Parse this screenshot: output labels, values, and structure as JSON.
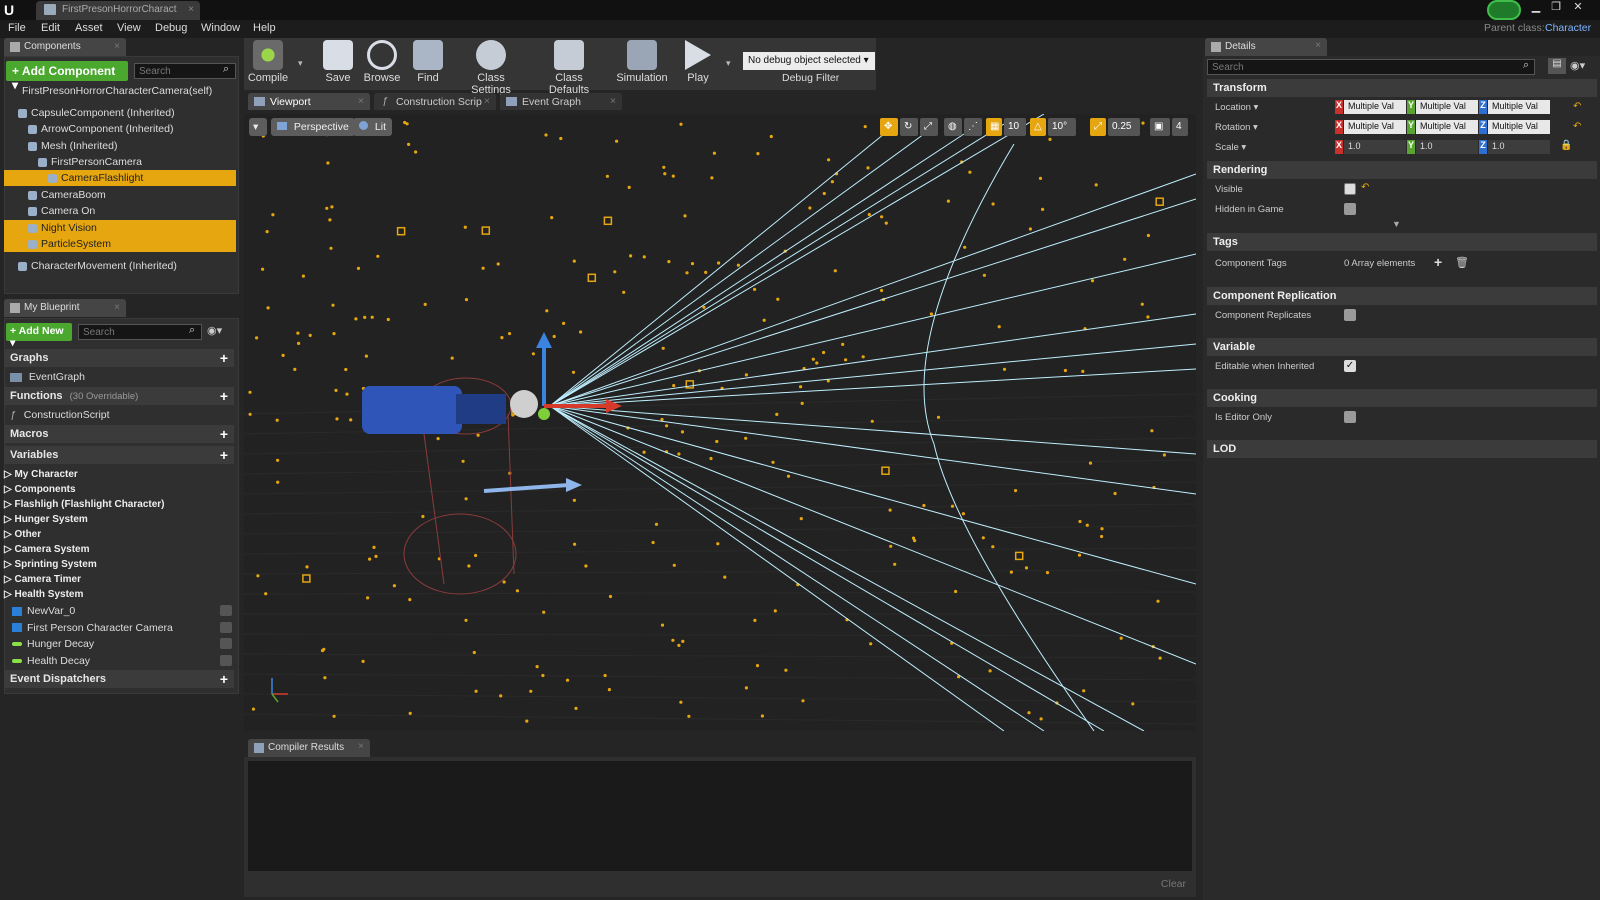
{
  "window": {
    "tab_title": "FirstPresonHorrorCharact",
    "parent_class_label": "Parent class:",
    "parent_class_value": "Character",
    "colors": {
      "accent": "#e5a60f",
      "green": "#4aa82e"
    }
  },
  "menu": [
    "File",
    "Edit",
    "Asset",
    "View",
    "Debug",
    "Window",
    "Help"
  ],
  "components_panel": {
    "tab": "Components",
    "add_button": "+ Add Component ▾",
    "search_placeholder": "Search",
    "self_label": "FirstPresonHorrorCharacterCamera(self)",
    "items": [
      {
        "label": "CapsuleComponent (Inherited)",
        "indent": 0,
        "selected": false
      },
      {
        "label": "ArrowComponent (Inherited)",
        "indent": 1,
        "selected": false
      },
      {
        "label": "Mesh (Inherited)",
        "indent": 1,
        "selected": false
      },
      {
        "label": "FirstPersonCamera",
        "indent": 2,
        "selected": false
      },
      {
        "label": "CameraFlashlight",
        "indent": 3,
        "selected": true
      },
      {
        "label": "CameraBoom",
        "indent": 1,
        "selected": false
      },
      {
        "label": "Camera On",
        "indent": 1,
        "selected": false
      },
      {
        "label": "Night Vision",
        "indent": 1,
        "selected": true
      },
      {
        "label": "ParticleSystem",
        "indent": 1,
        "selected": true
      },
      {
        "label": "CharacterMovement (Inherited)",
        "indent": 0,
        "selected": false
      }
    ]
  },
  "blueprint_panel": {
    "tab": "My Blueprint",
    "add_button": "+ Add New ▾",
    "search_placeholder": "Search",
    "graphs_header": "Graphs",
    "graphs_item": "EventGraph",
    "functions_header": "Functions",
    "functions_note": "(30 Overridable)",
    "functions_item": "ConstructionScript",
    "macros_header": "Macros",
    "variables_header": "Variables",
    "variable_categories": [
      "My Character",
      "Components",
      "Flashligh (Flashlight Character)",
      "Hunger System",
      "Other",
      "Camera System",
      "Sprinting System",
      "Camera Timer",
      "Health System"
    ],
    "variables": [
      {
        "name": "NewVar_0",
        "color": "#2a7fd6"
      },
      {
        "name": "First Person Character Camera",
        "color": "#2a7fd6"
      },
      {
        "name": "Hunger Decay",
        "color": "#8be04a"
      },
      {
        "name": "Health Decay",
        "color": "#8be04a"
      }
    ],
    "event_dispatchers": "Event Dispatchers"
  },
  "toolbar": {
    "buttons": [
      "Compile",
      "Save",
      "Browse",
      "Find",
      "Class Settings",
      "Class Defaults",
      "Simulation",
      "Play"
    ],
    "debug_select": "No debug object selected ▾",
    "debug_filter": "Debug Filter"
  },
  "editor_tabs": [
    "Viewport",
    "Construction Scrip",
    "Event Graph"
  ],
  "viewport": {
    "perspective": "Perspective",
    "lit": "Lit",
    "grid_snap": "10",
    "rot_snap": "10°",
    "scale_snap": "0.25",
    "cam_speed": "4"
  },
  "compiler": {
    "tab": "Compiler Results",
    "clear": "Clear"
  },
  "details": {
    "tab": "Details",
    "search_placeholder": "Search",
    "transform_header": "Transform",
    "location_label": "Location ▾",
    "rotation_label": "Rotation ▾",
    "scale_label": "Scale ▾",
    "multiple_val": "Multiple Val",
    "scale_value": "1.0",
    "rendering_header": "Rendering",
    "visible_label": "Visible",
    "hidden_label": "Hidden in Game",
    "tags_header": "Tags",
    "component_tags_label": "Component Tags",
    "array_elements": "0 Array elements",
    "replication_header": "Component Replication",
    "replicates_label": "Component Replicates",
    "variable_header": "Variable",
    "editable_label": "Editable when Inherited",
    "cooking_header": "Cooking",
    "editor_only_label": "Is Editor Only",
    "lod_header": "LOD"
  }
}
